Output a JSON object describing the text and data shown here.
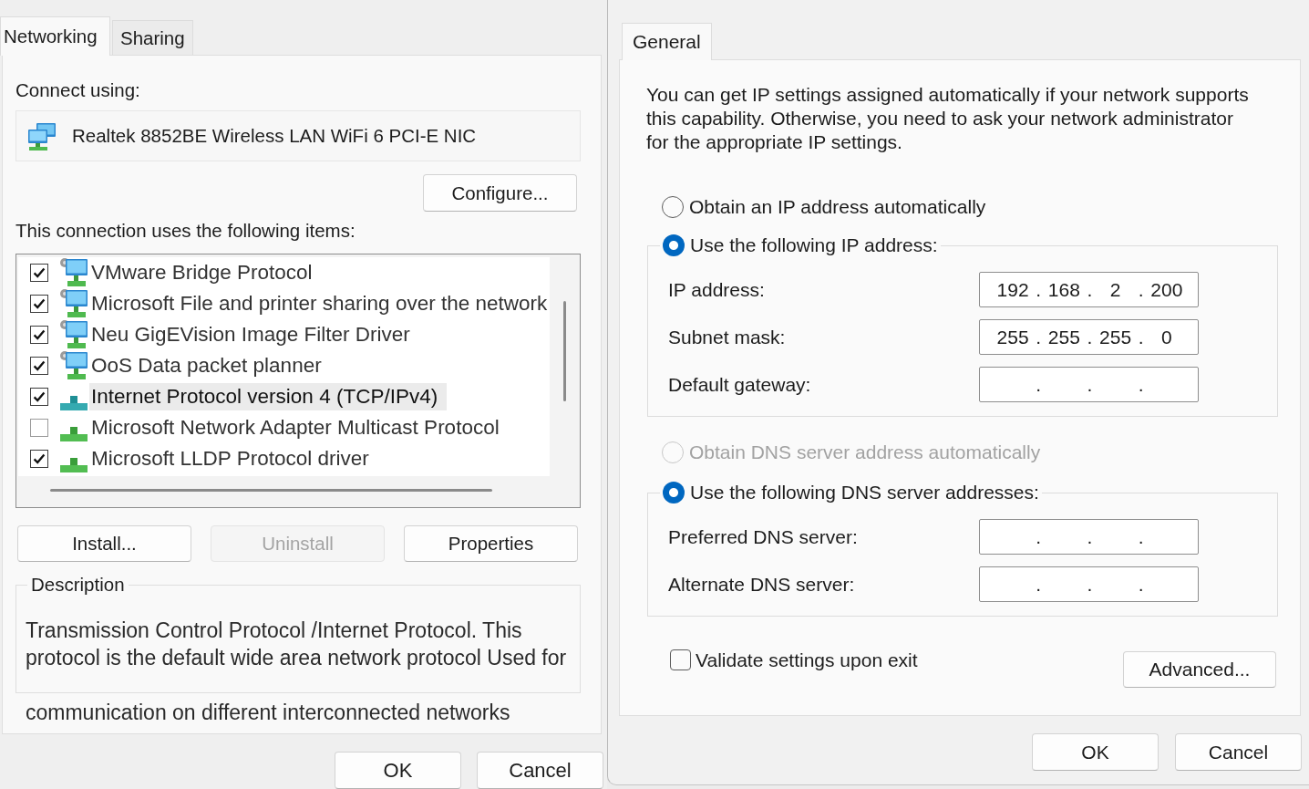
{
  "adapter_properties": {
    "tabs": [
      {
        "label": "Networking",
        "selected": true
      },
      {
        "label": "Sharing",
        "selected": false
      }
    ],
    "connect_using_label": "Connect using:",
    "adapter_name": "Realtek 8852BE Wireless LAN WiFi 6 PCI-E NIC",
    "configure_button": "Configure...",
    "items_label": "This connection uses the following items:",
    "items": [
      {
        "kind": "service",
        "label": "VMware Bridge Protocol",
        "checked": true,
        "selected": false
      },
      {
        "kind": "service",
        "label": "Microsoft File and printer sharing over the network",
        "checked": true,
        "selected": false
      },
      {
        "kind": "service",
        "label": "Neu GigEVision Image Filter Driver",
        "checked": true,
        "selected": false
      },
      {
        "kind": "service",
        "label": "OoS Data packet planner",
        "checked": true,
        "selected": false
      },
      {
        "kind": "protocol",
        "label": "Internet Protocol version 4 (TCP/IPv4)",
        "checked": true,
        "selected": true
      },
      {
        "kind": "protocol",
        "label": "Microsoft Network Adapter Multicast Protocol",
        "checked": false,
        "selected": false
      },
      {
        "kind": "protocol",
        "label": "Microsoft LLDP Protocol driver",
        "checked": true,
        "selected": false
      }
    ],
    "item_buttons": [
      {
        "label": "Install...",
        "disabled": false
      },
      {
        "label": "Uninstall",
        "disabled": true
      },
      {
        "label": "Properties",
        "disabled": false
      }
    ],
    "description": {
      "legend": "Description",
      "text": "Transmission Control Protocol /Internet Protocol. This protocol is the default wide area network protocol Used for",
      "continuation": "communication on different interconnected networks"
    },
    "footer_buttons": [
      "OK",
      "Cancel"
    ]
  },
  "ipv4_properties": {
    "tabs": [
      {
        "label": "General",
        "selected": true
      }
    ],
    "intro": "You can get IP settings assigned automatically if your network supports this capability. Otherwise, you need to ask your network administrator for the appropriate IP settings.",
    "ip": {
      "auto_option": {
        "label": "Obtain an IP address automatically",
        "selected": false,
        "disabled": false
      },
      "manual_option": {
        "label": "Use the following IP address:",
        "selected": true,
        "disabled": false
      },
      "fields": [
        {
          "label": "IP address:",
          "octets": [
            "192",
            "168",
            "2",
            "200"
          ],
          "dots": [
            ".",
            ".",
            "."
          ]
        },
        {
          "label": "Subnet mask:",
          "octets": [
            "255",
            "255",
            "255",
            "0"
          ],
          "dots": [
            ".",
            ".",
            "."
          ]
        },
        {
          "label": "Default gateway:",
          "dots": [
            ".",
            ".",
            "."
          ]
        }
      ]
    },
    "dns": {
      "auto_option": {
        "label": "Obtain DNS server address automatically",
        "selected": false,
        "disabled": true
      },
      "manual_option": {
        "label": "Use the following DNS server addresses:",
        "selected": true,
        "disabled": false
      },
      "fields": [
        {
          "label": "Preferred DNS server:",
          "dots": [
            ".",
            ".",
            "."
          ]
        },
        {
          "label": "Alternate DNS server:",
          "dots": [
            ".",
            ".",
            "."
          ]
        }
      ]
    },
    "validate_on_exit": {
      "label": "Validate settings upon exit",
      "checked": false
    },
    "advanced_button": "Advanced...",
    "footer_buttons": [
      "OK",
      "Cancel"
    ]
  }
}
